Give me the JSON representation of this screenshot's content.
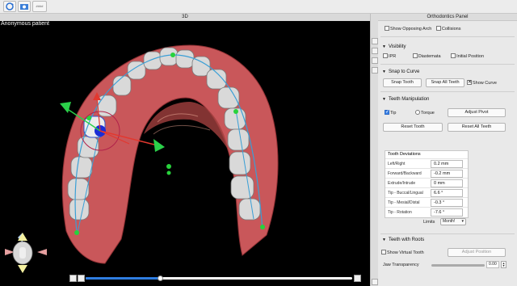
{
  "toolbar": {
    "icons": [
      "view-rotate-icon",
      "screenshot-icon",
      "grid-icon"
    ],
    "grid_label": "####"
  },
  "viewport": {
    "title": "3D",
    "patient_label": "Anonymous patient",
    "colors": {
      "gum": "#c9575a",
      "tooth": "#dcdcdc",
      "curve": "#3a9fd6",
      "control_point": "#28d23c",
      "pivot": "#1b2cd6"
    },
    "timeline_progress": 0.28
  },
  "panel": {
    "title": "Orthodontics Panel",
    "top_checks": [
      {
        "label": "Show Opposing Arch",
        "checked": false
      },
      {
        "label": "Collisions",
        "checked": false
      }
    ],
    "visibility": {
      "header": "Visibility",
      "items": [
        {
          "label": "IPR",
          "checked": false
        },
        {
          "label": "Diastemata",
          "checked": false
        },
        {
          "label": "Initial Position",
          "checked": false
        }
      ]
    },
    "snap": {
      "header": "Snap to Curve",
      "snap_tooth": "Snap Tooth",
      "snap_all": "Snap All Teeth",
      "show_curve": {
        "label": "Show Curve",
        "checked": true
      }
    },
    "manipulation": {
      "header": "Teeth Manipulation",
      "tip": {
        "label": "Tip",
        "checked": true
      },
      "torque": {
        "label": "Torque",
        "checked": false
      },
      "adjust_pivot": "Adjust Pivot",
      "reset_tooth": "Reset Tooth",
      "reset_all": "Reset All Teeth"
    },
    "deviations": {
      "title": "Tooth Deviations",
      "rows": [
        {
          "label": "Left/Right",
          "value": "0.2 mm"
        },
        {
          "label": "Forward/Backward",
          "value": "-0.2 mm"
        },
        {
          "label": "Extrude/Intrude",
          "value": "0 mm"
        },
        {
          "label": "Tip - Buccal/Lingual",
          "value": "6.6 °"
        },
        {
          "label": "Tip - Mesial/Distal",
          "value": "-0.3 °"
        },
        {
          "label": "Tip - Rotation",
          "value": "-7.6 °"
        }
      ]
    },
    "limits": {
      "label": "Limits",
      "value": "Month!"
    },
    "roots": {
      "header": "Teeth with Roots",
      "show_virtual": {
        "label": "Show Virtual Tooth",
        "checked": false
      },
      "adjust_position": "Adjust Position",
      "jaw_transparency": "Jaw Transparency",
      "jaw_transparency_value": "0.00"
    }
  }
}
